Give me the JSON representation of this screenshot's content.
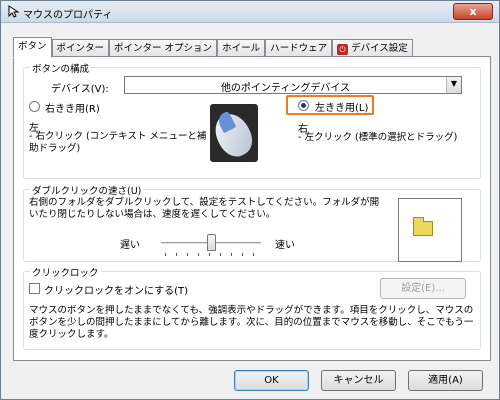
{
  "window": {
    "title": "マウスのプロパティ",
    "close_label": "x"
  },
  "tabs": [
    {
      "label": "ボタン",
      "active": true
    },
    {
      "label": "ポインター"
    },
    {
      "label": "ポインター オプション"
    },
    {
      "label": "ホイール"
    },
    {
      "label": "ハードウェア"
    },
    {
      "label": "デバイス設定",
      "icon": "device-settings-icon"
    }
  ],
  "button_config": {
    "group_title": "ボタンの構成",
    "device_label": "デバイス(V):",
    "device_value": "他のポインティングデバイス",
    "right_handed_label": "右きき用(R)",
    "left_handed_label": "左きき用(L)",
    "selected": "left",
    "left_desc_title": "左",
    "left_desc_body": " - 右クリック (コンテキスト メニューと補助ドラッグ)",
    "right_desc_title": "右",
    "right_desc_body": " - 左クリック (標準の選択とドラッグ)"
  },
  "double_click": {
    "group_title": "ダブルクリックの速さ(U)",
    "description": "右側のフォルダをダブルクリックして、設定をテストしてください。フォルダが開いたり閉じたりしない場合は、速度を遅くしてください。",
    "slow_label": "遅い",
    "fast_label": "速い",
    "slider_fraction": 0.5
  },
  "click_lock": {
    "group_title": "クリックロック",
    "checkbox_label": "クリックロックをオンにする(T)",
    "checked": false,
    "settings_label": "設定(E)...",
    "description": "マウスのボタンを押したままでなくても、強調表示やドラッグができます。項目をクリックし、マウスのボタンを少しの間押したままにしてから離します。次に、目的の位置までマウスを移動し、そこでもう一度クリックします。"
  },
  "footer": {
    "ok_label": "OK",
    "cancel_label": "キャンセル",
    "apply_label": "適用(A)"
  }
}
